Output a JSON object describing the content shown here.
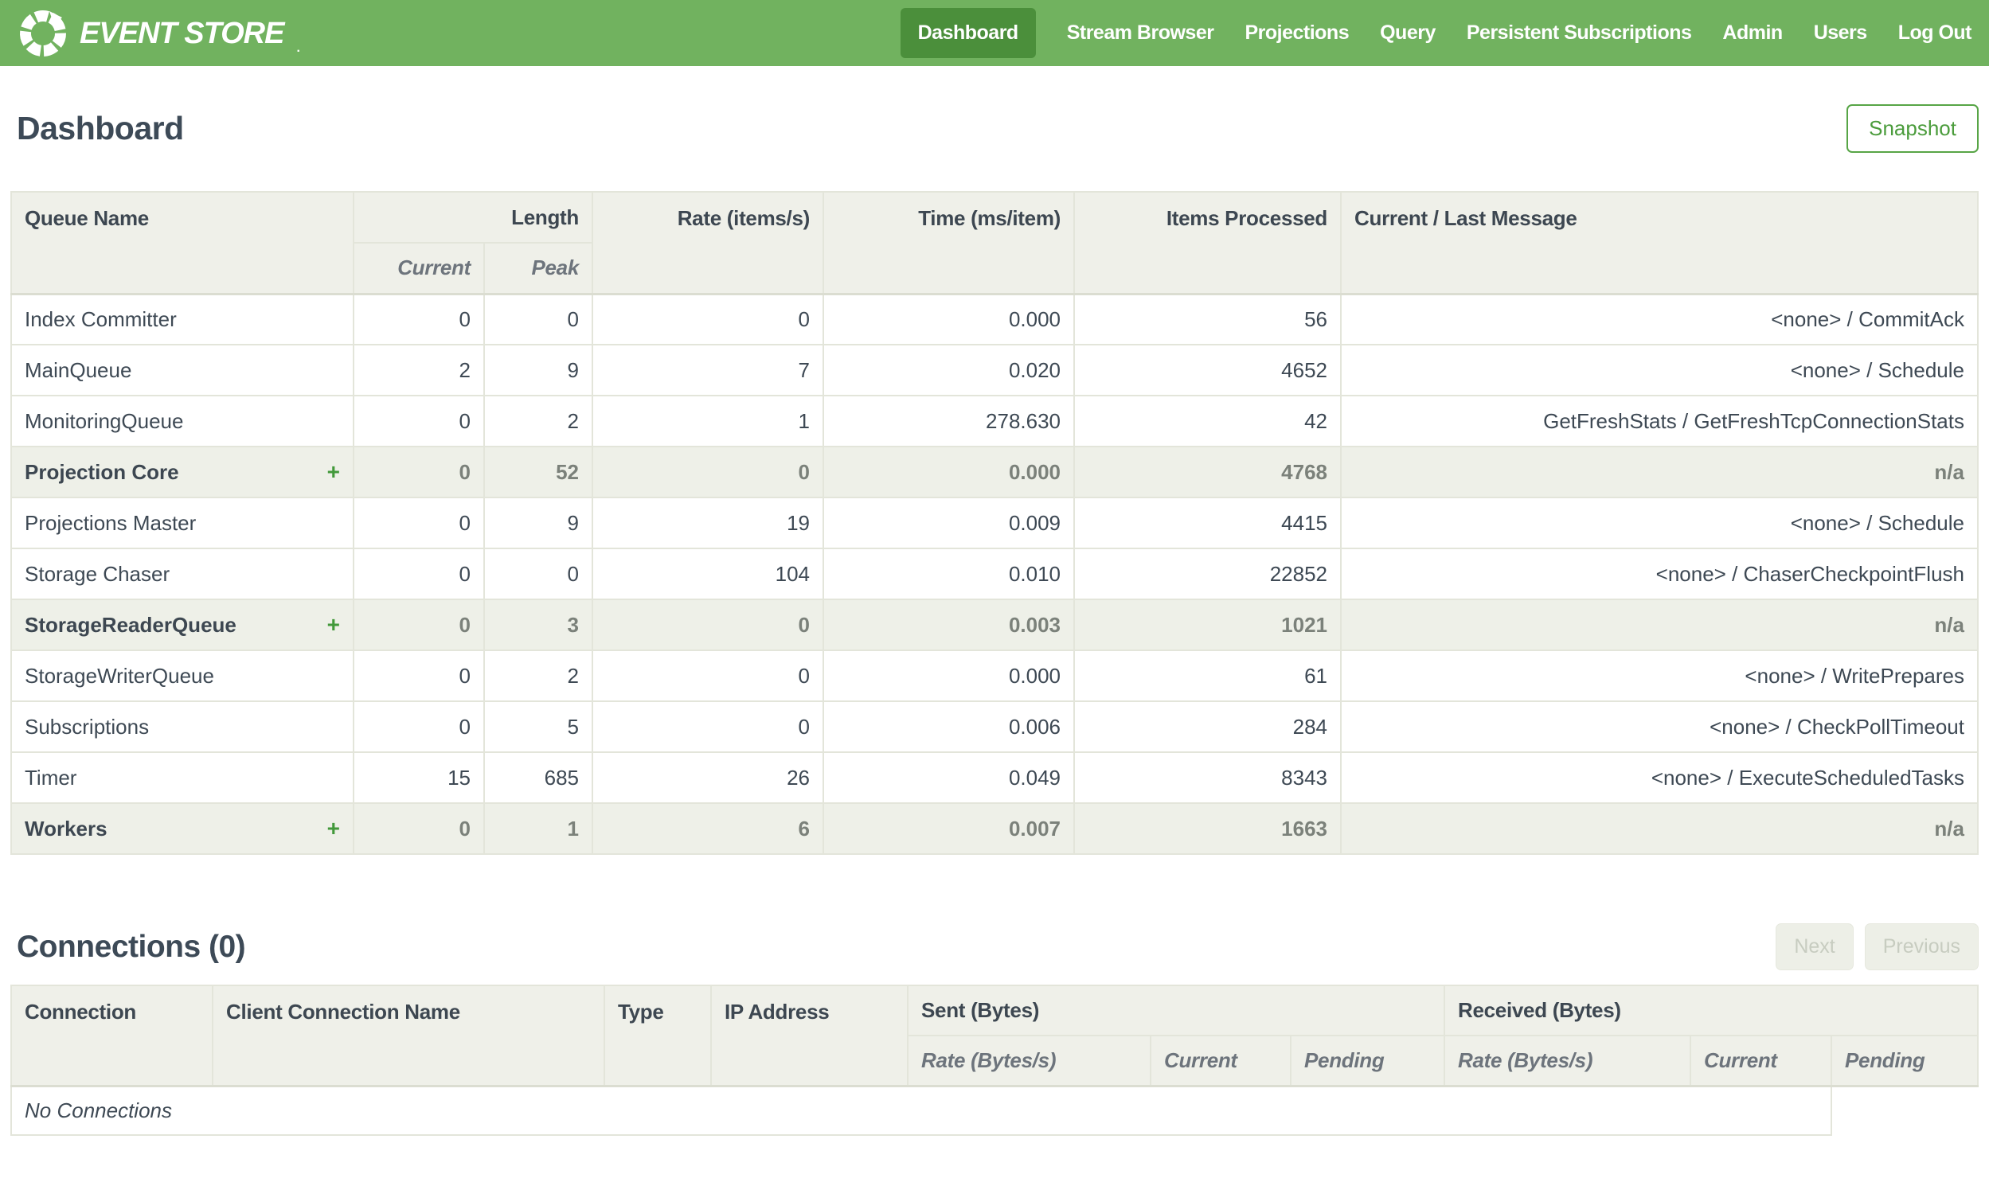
{
  "colors": {
    "header_green": "#71b25f",
    "active_tab_green": "#4b8f3b",
    "accent_green": "#4b9c3c",
    "dark_text": "#3d4a57",
    "table_header_bg": "#eff0e9",
    "group_row_bg": "#eef0e8",
    "border": "#e3e5da"
  },
  "header": {
    "logo_text": "EVENT STORE",
    "logo_tm": ".",
    "nav": [
      {
        "label": "Dashboard",
        "active": true
      },
      {
        "label": "Stream Browser",
        "active": false
      },
      {
        "label": "Projections",
        "active": false
      },
      {
        "label": "Query",
        "active": false
      },
      {
        "label": "Persistent Subscriptions",
        "active": false
      },
      {
        "label": "Admin",
        "active": false
      },
      {
        "label": "Users",
        "active": false
      },
      {
        "label": "Log Out",
        "active": false
      }
    ]
  },
  "page": {
    "title": "Dashboard",
    "snapshot_button": "Snapshot"
  },
  "queues": {
    "expand_symbol": "+",
    "headers": {
      "queue_name": "Queue Name",
      "length": "Length",
      "current": "Current",
      "peak": "Peak",
      "rate": "Rate (items/s)",
      "time": "Time (ms/item)",
      "items_processed": "Items Processed",
      "message": "Current / Last Message"
    },
    "rows": [
      {
        "name": "Index Committer",
        "group": false,
        "current": "0",
        "peak": "0",
        "rate": "0",
        "time": "0.000",
        "items": "56",
        "message": "<none> / CommitAck"
      },
      {
        "name": "MainQueue",
        "group": false,
        "current": "2",
        "peak": "9",
        "rate": "7",
        "time": "0.020",
        "items": "4652",
        "message": "<none> / Schedule"
      },
      {
        "name": "MonitoringQueue",
        "group": false,
        "current": "0",
        "peak": "2",
        "rate": "1",
        "time": "278.630",
        "items": "42",
        "message": "GetFreshStats / GetFreshTcpConnectionStats"
      },
      {
        "name": "Projection Core",
        "group": true,
        "current": "0",
        "peak": "52",
        "rate": "0",
        "time": "0.000",
        "items": "4768",
        "message": "n/a"
      },
      {
        "name": "Projections Master",
        "group": false,
        "current": "0",
        "peak": "9",
        "rate": "19",
        "time": "0.009",
        "items": "4415",
        "message": "<none> / Schedule"
      },
      {
        "name": "Storage Chaser",
        "group": false,
        "current": "0",
        "peak": "0",
        "rate": "104",
        "time": "0.010",
        "items": "22852",
        "message": "<none> / ChaserCheckpointFlush"
      },
      {
        "name": "StorageReaderQueue",
        "group": true,
        "current": "0",
        "peak": "3",
        "rate": "0",
        "time": "0.003",
        "items": "1021",
        "message": "n/a"
      },
      {
        "name": "StorageWriterQueue",
        "group": false,
        "current": "0",
        "peak": "2",
        "rate": "0",
        "time": "0.000",
        "items": "61",
        "message": "<none> / WritePrepares"
      },
      {
        "name": "Subscriptions",
        "group": false,
        "current": "0",
        "peak": "5",
        "rate": "0",
        "time": "0.006",
        "items": "284",
        "message": "<none> / CheckPollTimeout"
      },
      {
        "name": "Timer",
        "group": false,
        "current": "15",
        "peak": "685",
        "rate": "26",
        "time": "0.049",
        "items": "8343",
        "message": "<none> / ExecuteScheduledTasks"
      },
      {
        "name": "Workers",
        "group": true,
        "current": "0",
        "peak": "1",
        "rate": "6",
        "time": "0.007",
        "items": "1663",
        "message": "n/a"
      }
    ]
  },
  "connections": {
    "title": "Connections (0)",
    "next_button": "Next",
    "previous_button": "Previous",
    "headers": {
      "connection": "Connection",
      "client_name": "Client Connection Name",
      "type": "Type",
      "ip": "IP Address",
      "sent": "Sent (Bytes)",
      "received": "Received (Bytes)",
      "rate": "Rate (Bytes/s)",
      "current": "Current",
      "pending": "Pending"
    },
    "empty_text": "No Connections"
  }
}
